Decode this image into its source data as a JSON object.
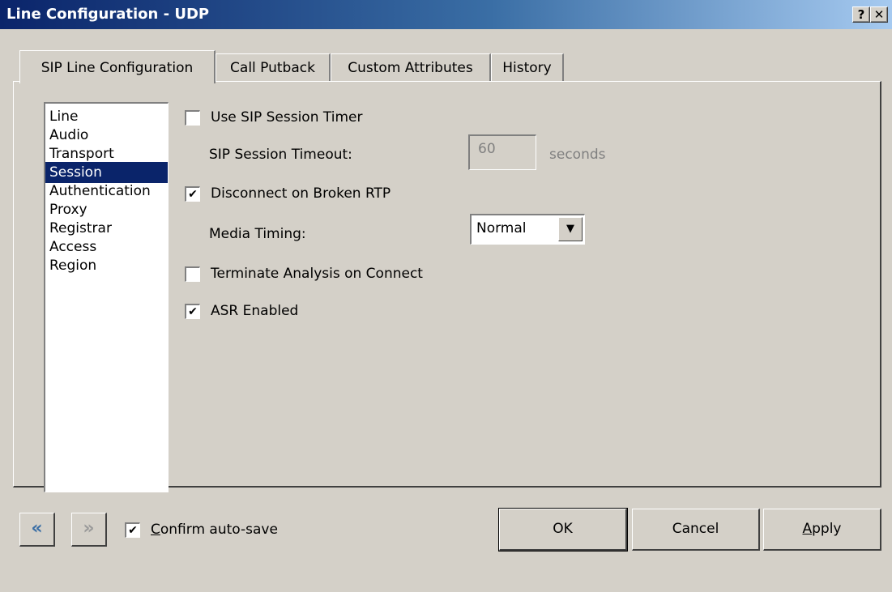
{
  "window": {
    "title": "Line Configuration - UDP",
    "help_label": "?",
    "close_label": "✕"
  },
  "tabs": [
    {
      "label": "SIP Line Configuration",
      "active": true
    },
    {
      "label": "Call Putback",
      "active": false
    },
    {
      "label": "Custom Attributes",
      "active": false
    },
    {
      "label": "History",
      "active": false
    }
  ],
  "sidebar": {
    "items": [
      {
        "label": "Line"
      },
      {
        "label": "Audio"
      },
      {
        "label": "Transport"
      },
      {
        "label": "Session",
        "selected": true
      },
      {
        "label": "Authentication"
      },
      {
        "label": "Proxy"
      },
      {
        "label": "Registrar"
      },
      {
        "label": "Access"
      },
      {
        "label": "Region"
      }
    ]
  },
  "session": {
    "use_sip_session_timer": {
      "label": "Use SIP Session Timer",
      "checked": false
    },
    "sip_session_timeout": {
      "label": "SIP Session Timeout:",
      "value": "60",
      "unit": "seconds"
    },
    "disconnect_on_broken_rtp": {
      "label": "Disconnect on Broken RTP",
      "checked": true
    },
    "media_timing": {
      "label": "Media Timing:",
      "value": "Normal"
    },
    "terminate_analysis_on_connect": {
      "label": "Terminate Analysis on Connect",
      "checked": false
    },
    "asr_enabled": {
      "label": "ASR Enabled",
      "checked": true
    }
  },
  "footer": {
    "back_glyph": "«",
    "forward_glyph": "»",
    "confirm_autosave": {
      "label_first": "C",
      "label_rest": "onfirm auto-save",
      "checked": true
    },
    "ok_label": "OK",
    "cancel_label": "Cancel",
    "apply_label_first": "A",
    "apply_label_rest": "pply"
  },
  "colors": {
    "title_bar": "#0a246a",
    "selection": "#0a246a",
    "nav_back_active": "#3a6ea5",
    "nav_forward_disabled": "#9a9a9a"
  }
}
